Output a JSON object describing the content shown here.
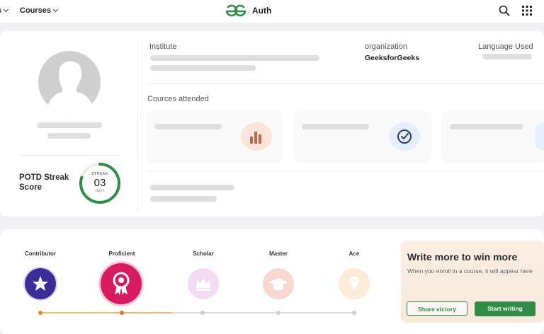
{
  "nav": {
    "left_partial": "s",
    "courses": "Courses",
    "brand": "Auth"
  },
  "profile": {
    "potd_label": "POTD Streak Score",
    "streak_title": "STREAK",
    "streak_value": "03",
    "streak_unit": "days",
    "streak_progress": 0.8
  },
  "details": {
    "institute_label": "Institute",
    "organization_label": "organization",
    "organization_value": "GeeksforGeeks",
    "language_label": "Language Used",
    "courses_label": "Cources attended"
  },
  "badges": [
    {
      "label": "Contributor"
    },
    {
      "label": "Proficient"
    },
    {
      "label": "Scholar"
    },
    {
      "label": "Master"
    },
    {
      "label": "Ace"
    }
  ],
  "badge_progress": 0.42,
  "promo": {
    "title": "Write more to win more",
    "subtitle": "When you enroll in a course, it will appear here",
    "share_button": "Share victory",
    "start_button": "Start writing"
  },
  "colors": {
    "brand_green": "#2f8d46",
    "streak_ring": "#2f8d46",
    "progress_fill": "#f3b26a"
  }
}
